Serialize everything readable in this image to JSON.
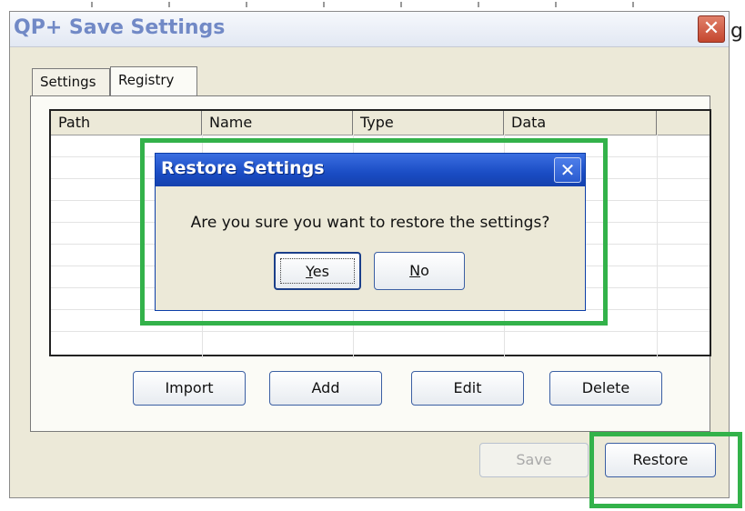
{
  "window": {
    "title": "QP+ Save Settings",
    "close_glyph": "✕"
  },
  "background": {
    "trailing_text": "g"
  },
  "tabs": [
    {
      "label": "Settings"
    },
    {
      "label": "Registry",
      "active": true
    }
  ],
  "table": {
    "columns": [
      "Path",
      "Name",
      "Type",
      "Data"
    ],
    "rows": []
  },
  "panel_buttons": {
    "import": "Import",
    "add": "Add",
    "edit": "Edit",
    "delete": "Delete"
  },
  "footer_buttons": {
    "save": "Save",
    "restore": "Restore",
    "save_enabled": false
  },
  "dialog": {
    "title": "Restore Settings",
    "close_glyph": "✕",
    "message": "Are you sure you want to restore the settings?",
    "yes": {
      "mnemonic": "Y",
      "rest": "es"
    },
    "no": {
      "mnemonic": "N",
      "rest": "o"
    }
  },
  "colors": {
    "highlight": "#33b24a",
    "dialog_title": "#1a4cc4",
    "window_title": "#7189c6"
  }
}
